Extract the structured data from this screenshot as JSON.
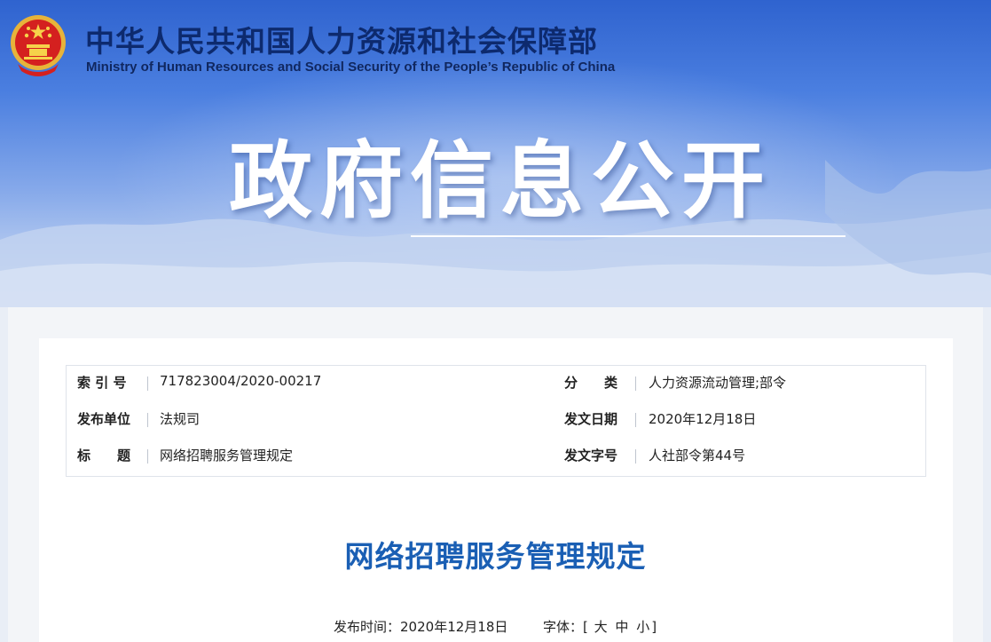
{
  "header": {
    "site_name_cn": "中华人民共和国人力资源和社会保障部",
    "site_name_en": "Ministry of Human Resources and Social Security of the People’s Republic of China",
    "emblem_icon": "national-emblem-icon",
    "hero_title": "政府信息公开"
  },
  "metadata": {
    "index_label": "索 引 号",
    "index_value": "717823004/2020-00217",
    "category_label": "分　　类",
    "category_value": "人力资源流动管理;部令",
    "issuer_label": "发布单位",
    "issuer_value": "法规司",
    "date_label": "发文日期",
    "date_value": "2020年12月18日",
    "title_label": "标　　题",
    "title_value": "网络招聘服务管理规定",
    "docno_label": "发文字号",
    "docno_value": "人社部令第44号"
  },
  "article": {
    "title": "网络招聘服务管理规定",
    "publish_label": "发布时间：",
    "publish_date": "2020年12月18日",
    "font_label": "字体：",
    "font_open": "[",
    "font_large": "大",
    "font_medium": "中",
    "font_small": "小",
    "font_close": "]"
  },
  "colors": {
    "banner_top": "#2f63cf",
    "title_blue": "#1a5fb4",
    "site_name": "#0d2a6e"
  }
}
